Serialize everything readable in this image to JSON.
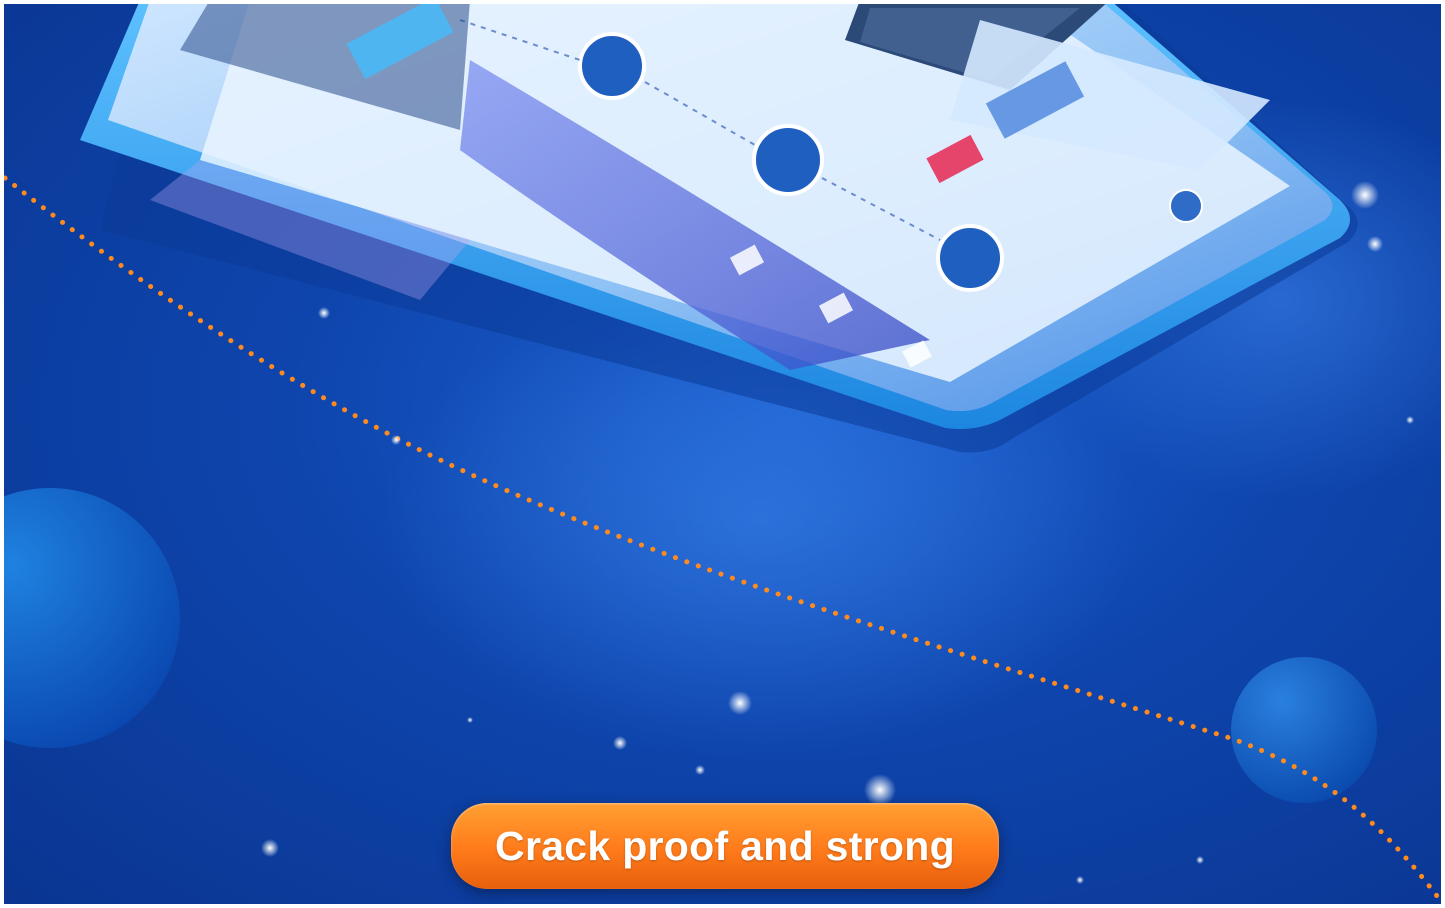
{
  "cta": {
    "label": "Crack proof and strong"
  },
  "colors": {
    "background": "#0e45ad",
    "button": "#ff7a1a",
    "dots": "#ff8a1e",
    "tablet_frame": "#3aa6f0"
  },
  "icons": [
    "tablet-device-icon",
    "planet-icon",
    "star-icon"
  ]
}
